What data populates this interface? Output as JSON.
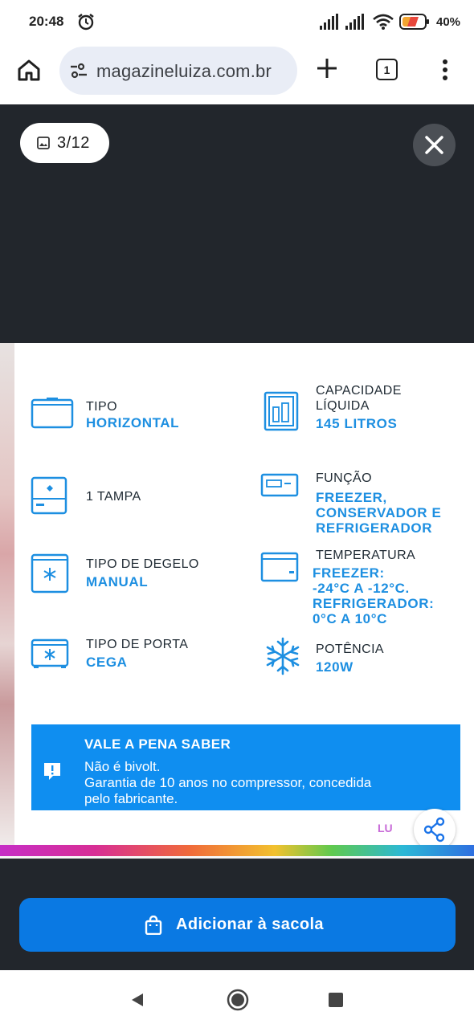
{
  "status_bar": {
    "time": "20:48",
    "battery": "40%"
  },
  "browser": {
    "url": "magazineluiza.com.br",
    "tab_count": "1"
  },
  "gallery": {
    "counter": "3/12"
  },
  "specs": {
    "left": [
      {
        "label": "TIPO",
        "value": "HORIZONTAL",
        "icon": "chest-freezer-icon"
      },
      {
        "label": "1 TAMPA",
        "value": "",
        "icon": "freezer-lid-icon"
      },
      {
        "label": "TIPO DE DEGELO",
        "value": "MANUAL",
        "icon": "defrost-icon"
      },
      {
        "label": "TIPO DE PORTA",
        "value": "CEGA",
        "icon": "solid-door-icon"
      }
    ],
    "right": [
      {
        "label_lines": [
          "CAPACIDADE",
          "LÍQUIDA"
        ],
        "value_lines": [
          "145 LITROS"
        ],
        "icon": "capacity-icon"
      },
      {
        "label_lines": [
          "FUNÇÃO"
        ],
        "value_lines": [
          "FREEZER,",
          "CONSERVADOR E",
          "REFRIGERADOR"
        ],
        "icon": "function-icon"
      },
      {
        "label_lines": [
          "TEMPERATURA"
        ],
        "value_lines": [
          "FREEZER:",
          "-24°C A -12°C.",
          "REFRIGERADOR:",
          "0°C A 10°C"
        ],
        "icon": "temperature-icon"
      },
      {
        "label_lines": [
          "POTÊNCIA"
        ],
        "value_lines": [
          "120W"
        ],
        "icon": "snowflake-icon"
      }
    ]
  },
  "info_box": {
    "title": "VALE A PENA SABER",
    "lines": [
      "Não é bivolt.",
      "Garantia de 10 anos no compressor, concedida",
      "pelo fabricante."
    ]
  },
  "brand_mark": "LU",
  "actions": {
    "add_to_bag": "Adicionar à sacola"
  },
  "colors": {
    "accent": "#0a79e3",
    "info": "#0f8ef0",
    "spec_value": "#1d8fe1",
    "gallery_bg": "#22262c"
  }
}
